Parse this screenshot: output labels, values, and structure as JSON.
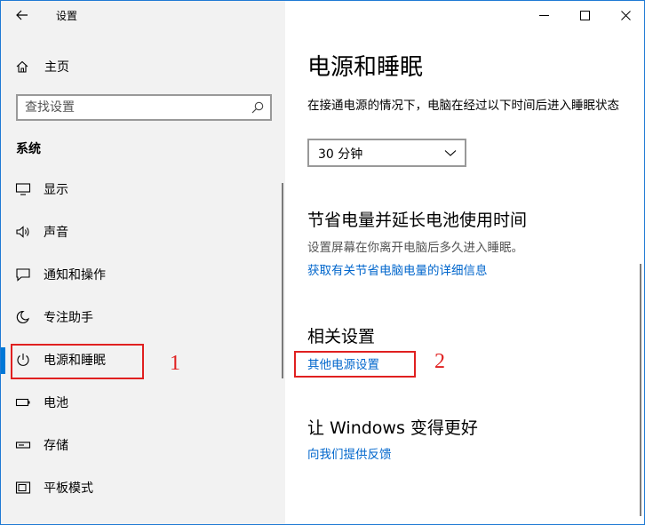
{
  "window": {
    "app_title": "设置"
  },
  "sidebar": {
    "home_label": "主页",
    "search_placeholder": "查找设置",
    "section_label": "系统",
    "items": [
      {
        "label": "显示",
        "icon": "monitor-icon"
      },
      {
        "label": "声音",
        "icon": "speaker-icon"
      },
      {
        "label": "通知和操作",
        "icon": "notification-icon"
      },
      {
        "label": "专注助手",
        "icon": "moon-icon"
      },
      {
        "label": "电源和睡眠",
        "icon": "power-icon",
        "active": true
      },
      {
        "label": "电池",
        "icon": "battery-icon"
      },
      {
        "label": "存储",
        "icon": "storage-icon"
      },
      {
        "label": "平板模式",
        "icon": "tablet-icon"
      }
    ]
  },
  "main": {
    "page_title": "电源和睡眠",
    "sleep_description": "在接通电源的情况下，电脑在经过以下时间后进入睡眠状态",
    "sleep_select_value": "30 分钟",
    "battery_saving": {
      "heading": "节省电量并延长电池使用时间",
      "subtext": "设置屏幕在你离开电脑后多久进入睡眠。",
      "link": "获取有关节省电脑电量的详细信息"
    },
    "related": {
      "heading": "相关设置",
      "link": "其他电源设置"
    },
    "feedback": {
      "heading": "让 Windows 变得更好",
      "link": "向我们提供反馈"
    }
  },
  "annotations": {
    "label_1": "1",
    "label_2": "2",
    "color": "#e02020"
  },
  "colors": {
    "accent": "#0078d7",
    "link": "#0066cc",
    "sidebar_bg": "#f2f2f2"
  }
}
